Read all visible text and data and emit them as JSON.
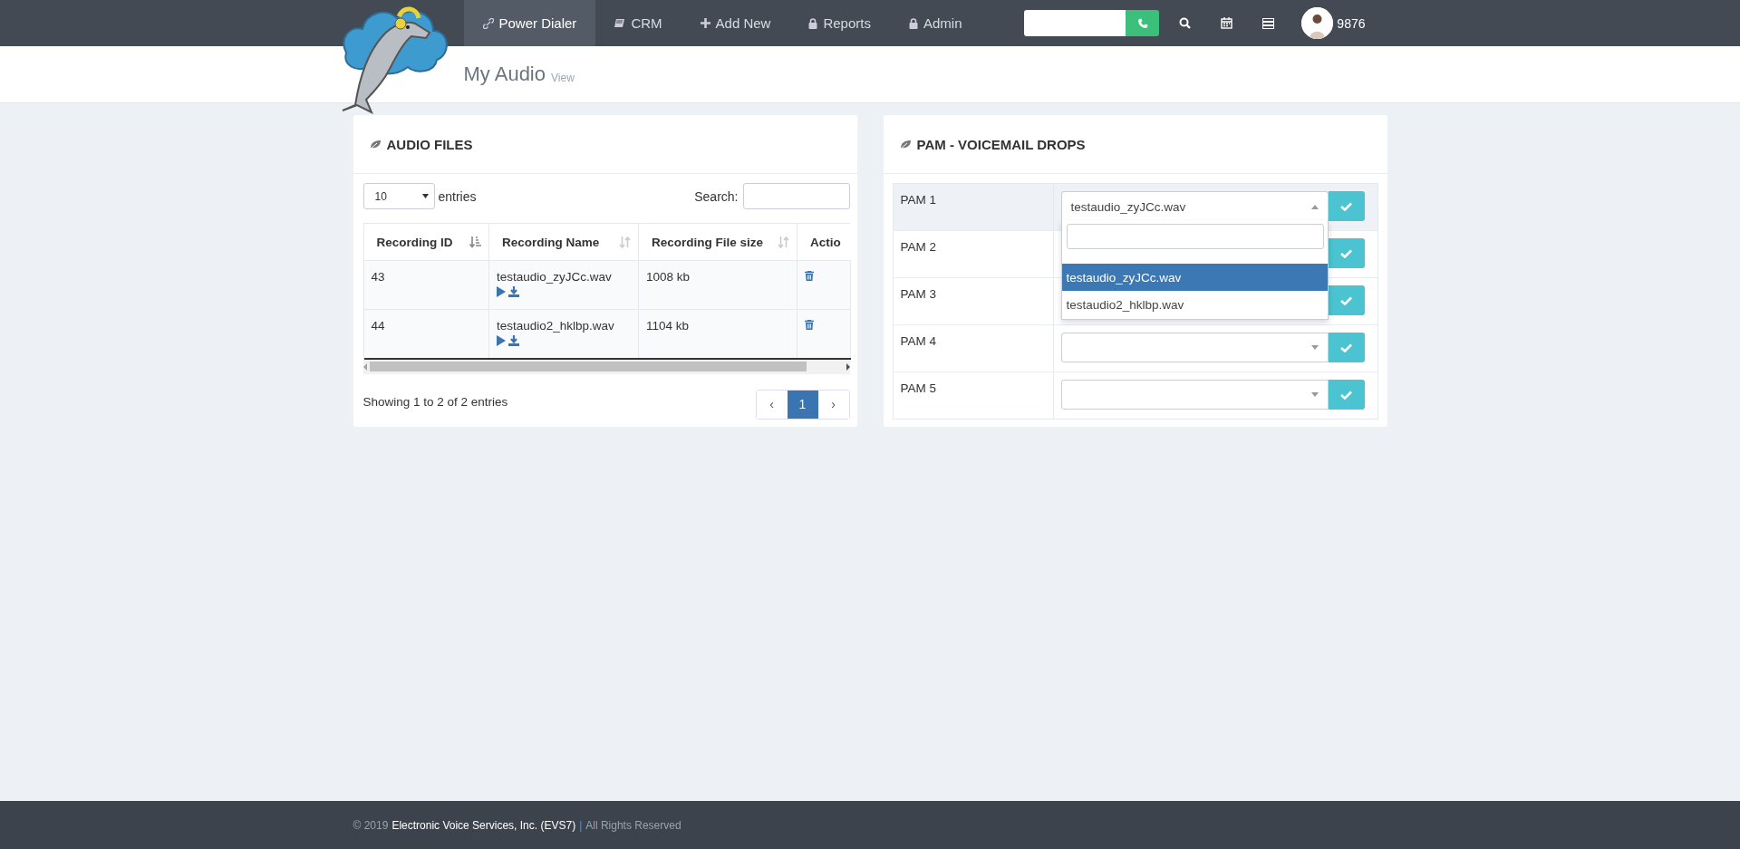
{
  "nav": {
    "items": [
      {
        "label": "Power Dialer",
        "selected": true
      },
      {
        "label": "CRM",
        "selected": false
      },
      {
        "label": "Add New",
        "selected": false
      },
      {
        "label": "Reports",
        "selected": false
      },
      {
        "label": "Admin",
        "selected": false
      }
    ],
    "user": "9876"
  },
  "page": {
    "title": "My Audio",
    "subtitle": "View"
  },
  "audio_files": {
    "title": "AUDIO FILES",
    "length_value": "10",
    "length_label": "entries",
    "search_label": "Search:",
    "columns": [
      {
        "label": "Recording ID",
        "sorted": true
      },
      {
        "label": "Recording Name",
        "sorted": false
      },
      {
        "label": "Recording File size",
        "sorted": false
      },
      {
        "label": "Actio"
      }
    ],
    "rows": [
      {
        "id": "43",
        "name": "testaudio_zyJCc.wav",
        "size": "1008 kb"
      },
      {
        "id": "44",
        "name": "testaudio2_hklbp.wav",
        "size": "1104 kb"
      }
    ],
    "info": "Showing 1 to 2 of 2 entries",
    "pagination": {
      "prev": "‹",
      "pages": [
        {
          "label": "1",
          "selected": true
        }
      ],
      "next": "›"
    }
  },
  "pam": {
    "title": "PAM - VOICEMAIL DROPS",
    "rows": [
      {
        "label": "PAM 1",
        "value": "testaudio_zyJCc.wav",
        "open": true
      },
      {
        "label": "PAM 2"
      },
      {
        "label": "PAM 3"
      },
      {
        "label": "PAM 4",
        "open": false
      },
      {
        "label": "PAM 5",
        "open": false
      }
    ],
    "options": [
      {
        "label": "testaudio_zyJCc.wav",
        "selected": true
      },
      {
        "label": "testaudio2_hklbp.wav",
        "selected": false
      }
    ]
  },
  "footer": {
    "year": "© 2019",
    "company": "Electronic Voice Services, Inc. (EVS7)",
    "separator": "|",
    "rights": "All Rights Reserved"
  }
}
